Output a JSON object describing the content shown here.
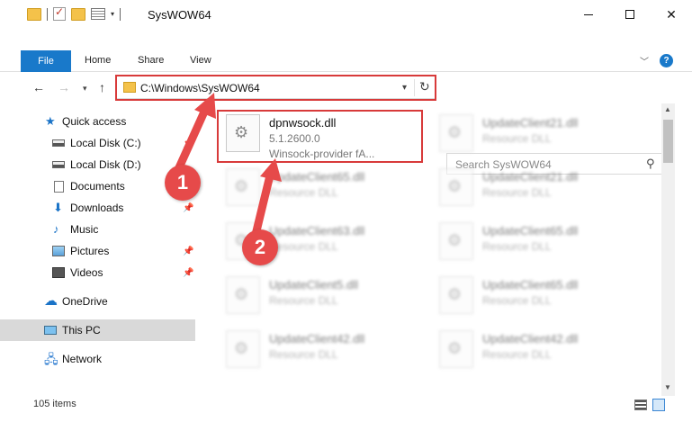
{
  "window": {
    "title": "SysWOW64"
  },
  "ribbon": {
    "tabs": [
      "File",
      "Home",
      "Share",
      "View"
    ]
  },
  "address": {
    "path": "C:\\Windows\\SysWOW64"
  },
  "search": {
    "placeholder": "Search SysWOW64"
  },
  "sidebar": {
    "items": [
      {
        "label": "Quick access",
        "icon": "star-icon"
      },
      {
        "label": "Local Disk (C:)",
        "icon": "disk-icon"
      },
      {
        "label": "Local Disk (D:)",
        "icon": "disk-icon"
      },
      {
        "label": "Documents",
        "icon": "documents-icon"
      },
      {
        "label": "Downloads",
        "icon": "download-icon"
      },
      {
        "label": "Music",
        "icon": "music-icon"
      },
      {
        "label": "Pictures",
        "icon": "pictures-icon"
      },
      {
        "label": "Videos",
        "icon": "videos-icon"
      },
      {
        "label": "OneDrive",
        "icon": "cloud-icon"
      },
      {
        "label": "This PC",
        "icon": "computer-icon"
      },
      {
        "label": "Network",
        "icon": "network-icon"
      }
    ]
  },
  "files": [
    {
      "name": "dpnwsock.dll",
      "version": "5.1.2600.0",
      "description": "Winsock-provider fA..."
    },
    {
      "name": "UpdateClient21.dll",
      "type": "Resource DLL"
    },
    {
      "name": "UpdateClient65.dll",
      "type": "Resource DLL"
    },
    {
      "name": "UpdateClient21.dll",
      "type": "Resource DLL"
    },
    {
      "name": "UpdateClient63.dll",
      "type": "Resource DLL"
    },
    {
      "name": "UpdateClient65.dll",
      "type": "Resource DLL"
    },
    {
      "name": "UpdateClient5.dll",
      "type": "Resource DLL"
    },
    {
      "name": "UpdateClient65.dll",
      "type": "Resource DLL"
    },
    {
      "name": "UpdateClient42.dll",
      "type": "Resource DLL"
    },
    {
      "name": "UpdateClient42.dll",
      "type": "Resource DLL"
    }
  ],
  "status": {
    "count": "105 items"
  },
  "markers": [
    "1",
    "2"
  ],
  "colors": {
    "accent": "#1979ca",
    "highlight": "#d83a3a",
    "marker": "#e64a4a",
    "folder": "#f4c24a"
  }
}
